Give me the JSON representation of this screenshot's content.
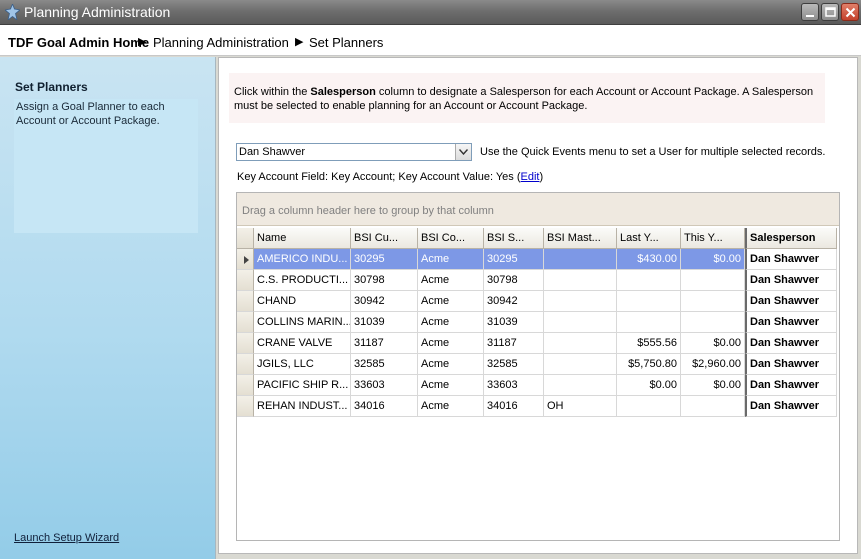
{
  "window": {
    "title": "Planning Administration"
  },
  "breadcrumb": {
    "home": "TDF Goal Admin Home",
    "section": "Planning Administration",
    "page": "Set Planners"
  },
  "left_panel": {
    "heading": "Set Planners",
    "description": "Assign a Goal Planner to each Account or Account Package.",
    "wizard_link": "Launch Setup Wizard"
  },
  "instructions": {
    "before": "Click within the ",
    "bold": "Salesperson",
    "after": " column to designate a Salesperson for each Account or Account Package.  A Salesperson must be selected to enable planning for an Account or Account Package."
  },
  "user_select": {
    "value": "Dan Shawver",
    "hint": "Use the Quick Events menu to set a User for multiple selected records."
  },
  "key_account": {
    "text": "Key Account Field: Key Account; Key Account Value: Yes (",
    "edit": "Edit",
    "close": ")"
  },
  "grid": {
    "group_hint": "Drag a column header here to group by that column",
    "columns": [
      "Name",
      "BSI Cu...",
      "BSI Co...",
      "BSI S...",
      "BSI Mast...",
      "Last Y...",
      "This Y...",
      "Salesperson"
    ],
    "rows": [
      [
        "AMERICO INDU...",
        "30295",
        "Acme",
        "30295",
        "",
        "$430.00",
        "$0.00",
        "Dan Shawver"
      ],
      [
        "C.S. PRODUCTI...",
        "30798",
        "Acme",
        "30798",
        "",
        "",
        "",
        "Dan Shawver"
      ],
      [
        "CHAND",
        "30942",
        "Acme",
        "30942",
        "",
        "",
        "",
        "Dan Shawver"
      ],
      [
        "COLLINS MARIN...",
        "31039",
        "Acme",
        "31039",
        "",
        "",
        "",
        "Dan Shawver"
      ],
      [
        "CRANE VALVE",
        "31187",
        "Acme",
        "31187",
        "",
        "$555.56",
        "$0.00",
        "Dan Shawver"
      ],
      [
        "JGILS, LLC",
        "32585",
        "Acme",
        "32585",
        "",
        "$5,750.80",
        "$2,960.00",
        "Dan Shawver"
      ],
      [
        "PACIFIC SHIP R...",
        "33603",
        "Acme",
        "33603",
        "",
        "$0.00",
        "$0.00",
        "Dan Shawver"
      ],
      [
        "REHAN INDUST...",
        "34016",
        "Acme",
        "34016",
        "OH",
        "",
        "",
        "Dan Shawver"
      ]
    ],
    "selected_row": 0
  }
}
